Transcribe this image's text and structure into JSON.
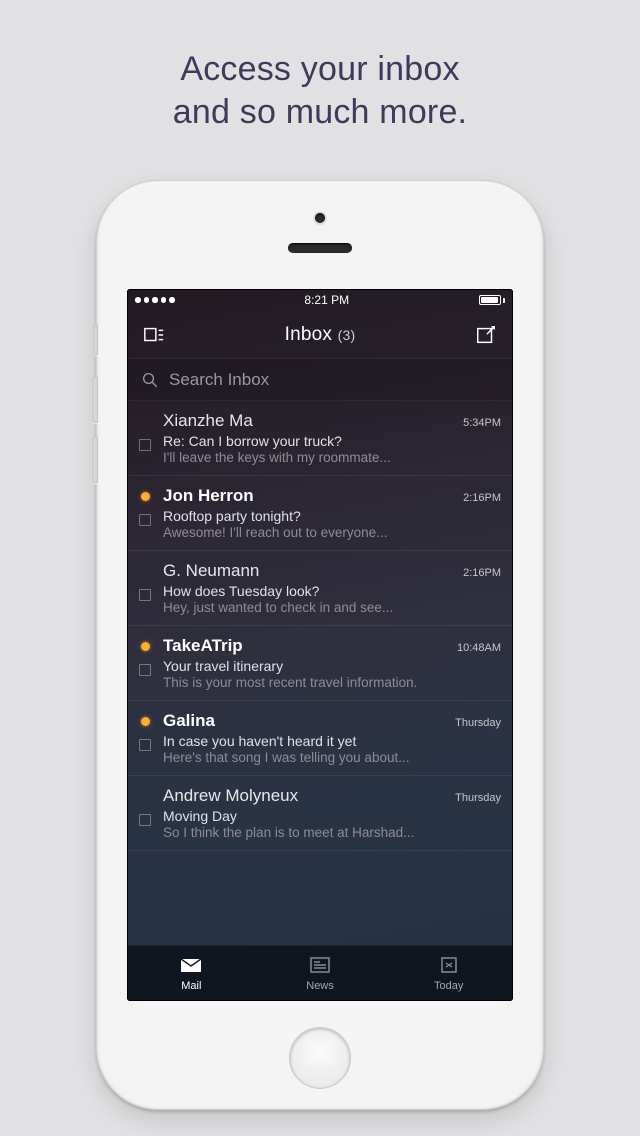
{
  "headline_line1": "Access your inbox",
  "headline_line2": "and so much more.",
  "status": {
    "time": "8:21 PM"
  },
  "nav": {
    "title": "Inbox",
    "count": "(3)"
  },
  "search": {
    "placeholder": "Search Inbox"
  },
  "emails": [
    {
      "sender": "Xianzhe Ma",
      "time": "5:34PM",
      "subject": "Re: Can I borrow your truck?",
      "preview": "I'll leave the keys with my roommate...",
      "unread": false
    },
    {
      "sender": "Jon Herron",
      "time": "2:16PM",
      "subject": "Rooftop party tonight?",
      "preview": "Awesome! I'll reach out to everyone...",
      "unread": true
    },
    {
      "sender": "G. Neumann",
      "time": "2:16PM",
      "subject": "How does Tuesday look?",
      "preview": "Hey, just wanted to check in and see...",
      "unread": false
    },
    {
      "sender": "TakeATrip",
      "time": "10:48AM",
      "subject": "Your travel itinerary",
      "preview": "This is your most recent travel information.",
      "unread": true
    },
    {
      "sender": "Galina",
      "time": "Thursday",
      "subject": "In case you haven't heard it yet",
      "preview": "Here's that song I was telling you about...",
      "unread": true
    },
    {
      "sender": "Andrew Molyneux",
      "time": "Thursday",
      "subject": "Moving Day",
      "preview": "So I think the plan is to meet at Harshad...",
      "unread": false
    }
  ],
  "tabs": [
    {
      "label": "Mail",
      "active": true
    },
    {
      "label": "News",
      "active": false
    },
    {
      "label": "Today",
      "active": false
    }
  ]
}
